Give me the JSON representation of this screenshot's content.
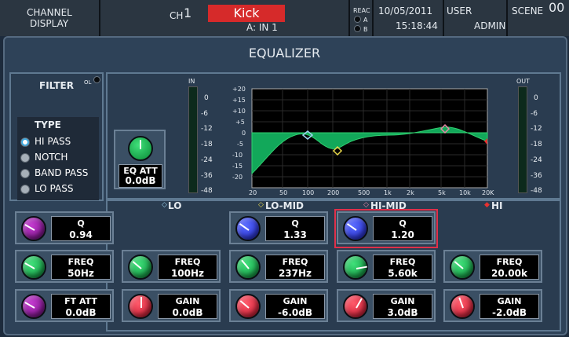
{
  "topbar": {
    "screen_title_line1": "CHANNEL",
    "screen_title_line2": "DISPLAY",
    "ch_prefix": "CH",
    "ch_number": "1",
    "channel_name": "Kick",
    "input_patch": "A: IN 1",
    "reac_label": "REAC",
    "reac_a": "A",
    "reac_b": "B",
    "date": "10/05/2011",
    "time": "15:18:44",
    "user_label": "USER",
    "user_name": "ADMIN",
    "scene_label": "SCENE",
    "scene_number": "00"
  },
  "title": "EQUALIZER",
  "filter": {
    "label": "FILTER",
    "ol_label": "OL",
    "type_label": "TYPE",
    "types": [
      "HI PASS",
      "NOTCH",
      "BAND PASS",
      "LO PASS"
    ],
    "selected": "HI PASS",
    "q_label": "Q",
    "q_value": "0.94",
    "freq_label": "FREQ",
    "freq_value": "50Hz",
    "att_label": "FT ATT",
    "att_value": "0.0dB"
  },
  "eq_att": {
    "label": "EQ ATT",
    "value": "0.0dB"
  },
  "meters": {
    "in_label": "IN",
    "out_label": "OUT",
    "scale": [
      "0",
      "-6",
      "-12",
      "-18",
      "-24",
      "-36",
      "-48"
    ]
  },
  "graph": {
    "y_ticks": [
      "+20",
      "+15",
      "+10",
      "+5",
      "0",
      "-5",
      "-10",
      "-15",
      "-20"
    ],
    "x_ticks": [
      "20",
      "50",
      "100",
      "200",
      "500",
      "1k",
      "2k",
      "5k",
      "10k",
      "20K"
    ]
  },
  "bands": {
    "lo": {
      "label": "LO",
      "freq_value": "100Hz",
      "gain_value": "0.0dB"
    },
    "lomid": {
      "label": "LO-MID",
      "q_value": "1.33",
      "freq_value": "237Hz",
      "gain_value": "-6.0dB"
    },
    "himid": {
      "label": "HI-MID",
      "q_value": "1.20",
      "freq_value": "5.60k",
      "gain_value": "3.0dB"
    },
    "hi": {
      "label": "HI",
      "freq_value": "20.00k",
      "gain_value": "-2.0dB"
    }
  },
  "labels": {
    "q": "Q",
    "freq": "FREQ",
    "gain": "GAIN"
  },
  "colors": {
    "lo": "#9cd3f0",
    "lomid": "#e8d84a",
    "himid": "#e88aa8",
    "hi": "#e83030",
    "eq_curve": "#12a85a"
  }
}
